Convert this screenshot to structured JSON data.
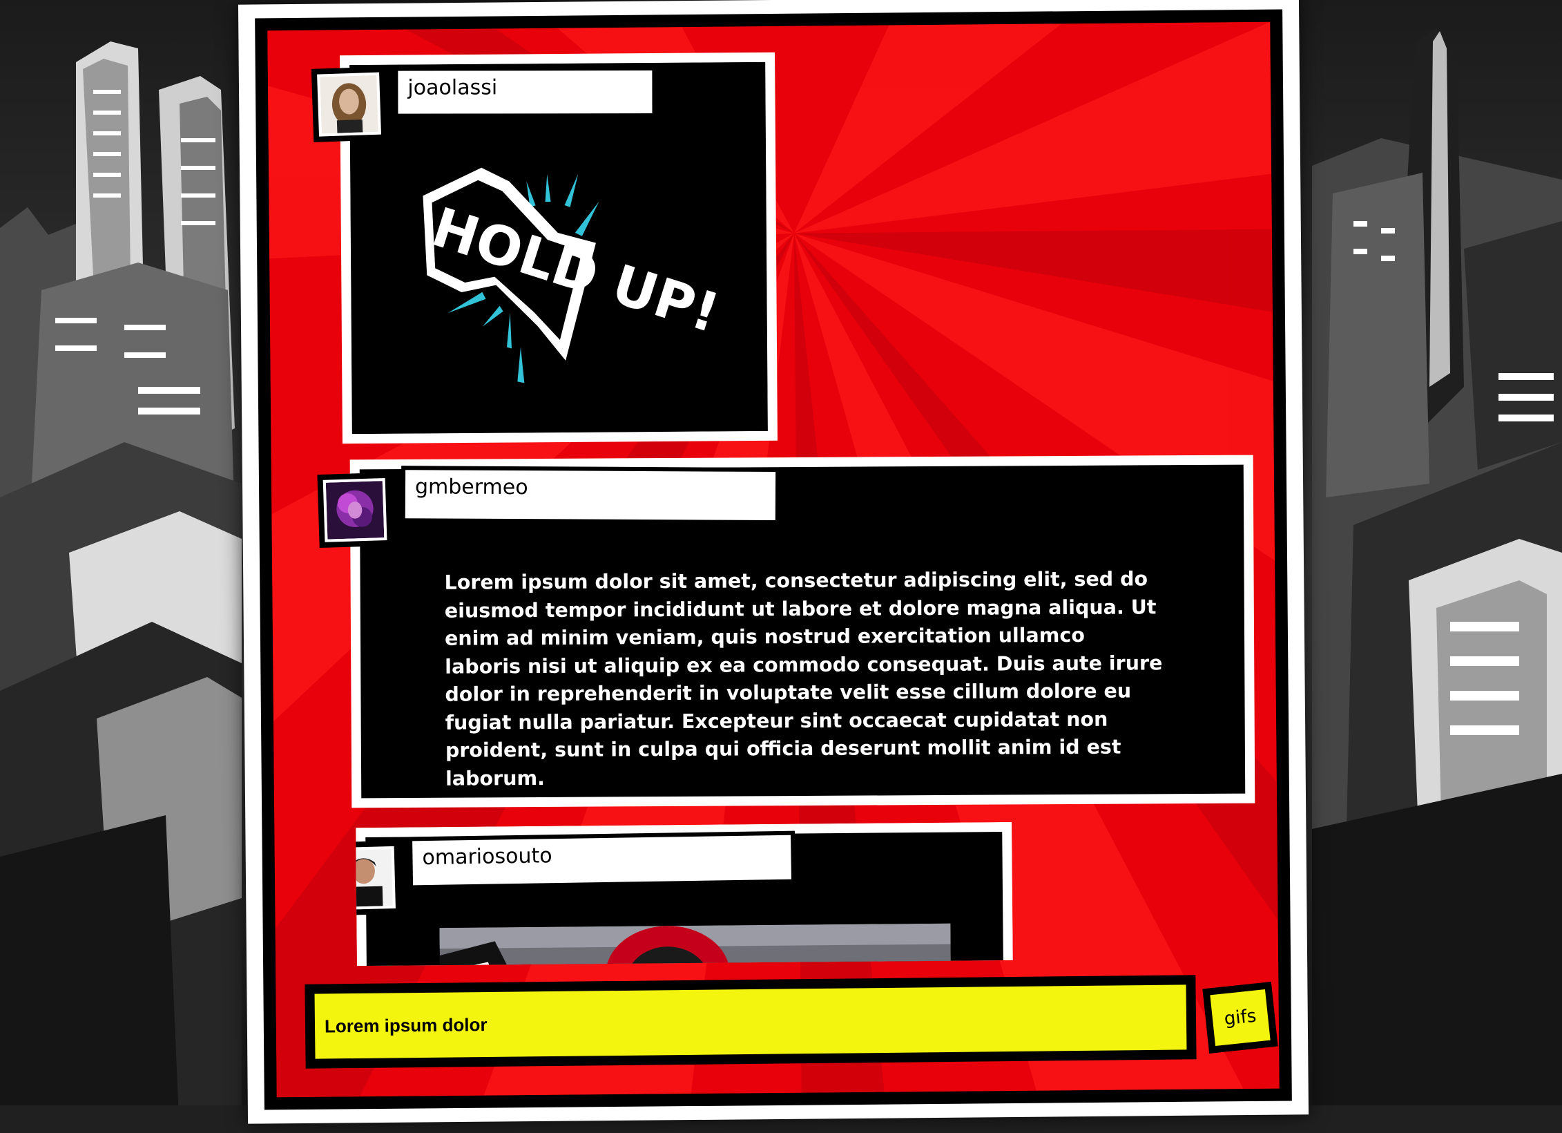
{
  "messages": [
    {
      "username": "joaolassi",
      "type": "gif",
      "gif_text": "HOLD UP!"
    },
    {
      "username": "gmbermeo",
      "type": "text",
      "text": "Lorem ipsum dolor sit amet, consectetur adipiscing elit, sed do eiusmod tempor incididunt ut labore et dolore magna aliqua. Ut enim ad minim veniam, quis nostrud exercitation ullamco laboris nisi ut aliquip ex ea commodo consequat. Duis aute irure dolor in reprehenderit in voluptate velit esse cillum dolore eu fugiat nulla pariatur. Excepteur sint occaecat cupidatat non proident, sunt in culpa qui officia deserunt mollit anim id est laborum."
    },
    {
      "username": "omariosouto",
      "type": "image"
    }
  ],
  "composer": {
    "value": "Lorem ipsum dolor",
    "gifs_label": "gifs"
  },
  "colors": {
    "panel_red": "#e8000a",
    "input_yellow": "#f4f50f",
    "gif_accent": "#33c3d9"
  }
}
